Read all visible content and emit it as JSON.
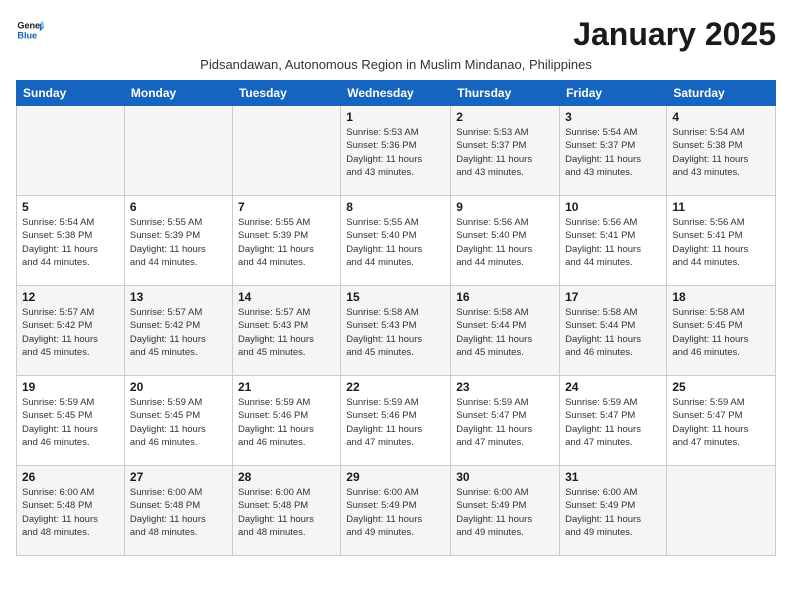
{
  "logo": {
    "line1": "General",
    "line2": "Blue"
  },
  "title": "January 2025",
  "subtitle": "Pidsandawan, Autonomous Region in Muslim Mindanao, Philippines",
  "headers": [
    "Sunday",
    "Monday",
    "Tuesday",
    "Wednesday",
    "Thursday",
    "Friday",
    "Saturday"
  ],
  "weeks": [
    [
      {
        "day": "",
        "info": ""
      },
      {
        "day": "",
        "info": ""
      },
      {
        "day": "",
        "info": ""
      },
      {
        "day": "1",
        "info": "Sunrise: 5:53 AM\nSunset: 5:36 PM\nDaylight: 11 hours\nand 43 minutes."
      },
      {
        "day": "2",
        "info": "Sunrise: 5:53 AM\nSunset: 5:37 PM\nDaylight: 11 hours\nand 43 minutes."
      },
      {
        "day": "3",
        "info": "Sunrise: 5:54 AM\nSunset: 5:37 PM\nDaylight: 11 hours\nand 43 minutes."
      },
      {
        "day": "4",
        "info": "Sunrise: 5:54 AM\nSunset: 5:38 PM\nDaylight: 11 hours\nand 43 minutes."
      }
    ],
    [
      {
        "day": "5",
        "info": "Sunrise: 5:54 AM\nSunset: 5:38 PM\nDaylight: 11 hours\nand 44 minutes."
      },
      {
        "day": "6",
        "info": "Sunrise: 5:55 AM\nSunset: 5:39 PM\nDaylight: 11 hours\nand 44 minutes."
      },
      {
        "day": "7",
        "info": "Sunrise: 5:55 AM\nSunset: 5:39 PM\nDaylight: 11 hours\nand 44 minutes."
      },
      {
        "day": "8",
        "info": "Sunrise: 5:55 AM\nSunset: 5:40 PM\nDaylight: 11 hours\nand 44 minutes."
      },
      {
        "day": "9",
        "info": "Sunrise: 5:56 AM\nSunset: 5:40 PM\nDaylight: 11 hours\nand 44 minutes."
      },
      {
        "day": "10",
        "info": "Sunrise: 5:56 AM\nSunset: 5:41 PM\nDaylight: 11 hours\nand 44 minutes."
      },
      {
        "day": "11",
        "info": "Sunrise: 5:56 AM\nSunset: 5:41 PM\nDaylight: 11 hours\nand 44 minutes."
      }
    ],
    [
      {
        "day": "12",
        "info": "Sunrise: 5:57 AM\nSunset: 5:42 PM\nDaylight: 11 hours\nand 45 minutes."
      },
      {
        "day": "13",
        "info": "Sunrise: 5:57 AM\nSunset: 5:42 PM\nDaylight: 11 hours\nand 45 minutes."
      },
      {
        "day": "14",
        "info": "Sunrise: 5:57 AM\nSunset: 5:43 PM\nDaylight: 11 hours\nand 45 minutes."
      },
      {
        "day": "15",
        "info": "Sunrise: 5:58 AM\nSunset: 5:43 PM\nDaylight: 11 hours\nand 45 minutes."
      },
      {
        "day": "16",
        "info": "Sunrise: 5:58 AM\nSunset: 5:44 PM\nDaylight: 11 hours\nand 45 minutes."
      },
      {
        "day": "17",
        "info": "Sunrise: 5:58 AM\nSunset: 5:44 PM\nDaylight: 11 hours\nand 46 minutes."
      },
      {
        "day": "18",
        "info": "Sunrise: 5:58 AM\nSunset: 5:45 PM\nDaylight: 11 hours\nand 46 minutes."
      }
    ],
    [
      {
        "day": "19",
        "info": "Sunrise: 5:59 AM\nSunset: 5:45 PM\nDaylight: 11 hours\nand 46 minutes."
      },
      {
        "day": "20",
        "info": "Sunrise: 5:59 AM\nSunset: 5:45 PM\nDaylight: 11 hours\nand 46 minutes."
      },
      {
        "day": "21",
        "info": "Sunrise: 5:59 AM\nSunset: 5:46 PM\nDaylight: 11 hours\nand 46 minutes."
      },
      {
        "day": "22",
        "info": "Sunrise: 5:59 AM\nSunset: 5:46 PM\nDaylight: 11 hours\nand 47 minutes."
      },
      {
        "day": "23",
        "info": "Sunrise: 5:59 AM\nSunset: 5:47 PM\nDaylight: 11 hours\nand 47 minutes."
      },
      {
        "day": "24",
        "info": "Sunrise: 5:59 AM\nSunset: 5:47 PM\nDaylight: 11 hours\nand 47 minutes."
      },
      {
        "day": "25",
        "info": "Sunrise: 5:59 AM\nSunset: 5:47 PM\nDaylight: 11 hours\nand 47 minutes."
      }
    ],
    [
      {
        "day": "26",
        "info": "Sunrise: 6:00 AM\nSunset: 5:48 PM\nDaylight: 11 hours\nand 48 minutes."
      },
      {
        "day": "27",
        "info": "Sunrise: 6:00 AM\nSunset: 5:48 PM\nDaylight: 11 hours\nand 48 minutes."
      },
      {
        "day": "28",
        "info": "Sunrise: 6:00 AM\nSunset: 5:48 PM\nDaylight: 11 hours\nand 48 minutes."
      },
      {
        "day": "29",
        "info": "Sunrise: 6:00 AM\nSunset: 5:49 PM\nDaylight: 11 hours\nand 49 minutes."
      },
      {
        "day": "30",
        "info": "Sunrise: 6:00 AM\nSunset: 5:49 PM\nDaylight: 11 hours\nand 49 minutes."
      },
      {
        "day": "31",
        "info": "Sunrise: 6:00 AM\nSunset: 5:49 PM\nDaylight: 11 hours\nand 49 minutes."
      },
      {
        "day": "",
        "info": ""
      }
    ]
  ]
}
